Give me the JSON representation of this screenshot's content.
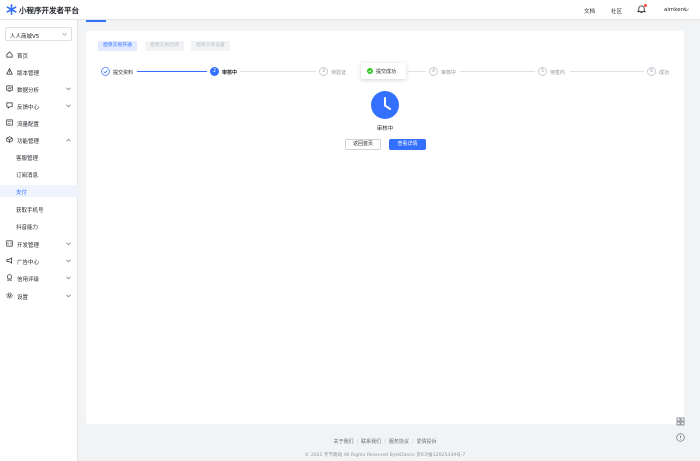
{
  "header": {
    "app_title": "小程序开发者平台",
    "links": [
      "文档",
      "社区"
    ],
    "user_name": "aimkent"
  },
  "sidebar": {
    "app_selector": "人人商城V5",
    "items": [
      {
        "label": "首页",
        "icon": "home-icon"
      },
      {
        "label": "版本管理",
        "icon": "version-icon"
      },
      {
        "label": "数据分析",
        "icon": "chart-icon",
        "expandable": true
      },
      {
        "label": "反馈中心",
        "icon": "feedback-icon",
        "expandable": true
      },
      {
        "label": "流量配置",
        "icon": "traffic-icon"
      },
      {
        "label": "功能管理",
        "icon": "feature-icon",
        "expandable": true,
        "expanded": true
      },
      {
        "label": "开发管理",
        "icon": "dev-icon",
        "expandable": true
      },
      {
        "label": "广告中心",
        "icon": "ad-icon",
        "expandable": true
      },
      {
        "label": "信用评级",
        "icon": "credit-icon",
        "expandable": true
      },
      {
        "label": "设置",
        "icon": "settings-icon",
        "expandable": true
      }
    ],
    "sub_items": [
      "客服管理",
      "订阅消息",
      "支付",
      "获取手机号",
      "抖音能力"
    ],
    "active_sub_item": "支付"
  },
  "tabs": [
    {
      "label": "担保交易开通",
      "state": "active"
    },
    {
      "label": "担保交易回调",
      "state": "disabled"
    },
    {
      "label": "担保交易设置",
      "state": "disabled"
    }
  ],
  "steps": [
    {
      "label": "提交资料",
      "state": "done",
      "index": "1"
    },
    {
      "label": "审核中",
      "state": "current",
      "index": "2"
    },
    {
      "label": "待验证",
      "state": "pending",
      "index": "3"
    },
    {
      "label": "审核中",
      "state": "pending",
      "index": "4"
    },
    {
      "label": "待签约",
      "state": "pending",
      "index": "5"
    },
    {
      "label": "成功",
      "state": "pending",
      "index": "6"
    }
  ],
  "toast": {
    "message": "提交成功"
  },
  "status": {
    "label": "审核中",
    "back_button": "返回首页",
    "detail_button": "查看详情"
  },
  "footer": {
    "links": [
      "关于我们",
      "联系我们",
      "服务协议",
      "爱情投诉"
    ],
    "copyright": "© 2021 字节跳动 All Rights Reserved ByteDance 京ICP备12025439号-7"
  },
  "colors": {
    "accent": "#3370ff",
    "success": "#34c724",
    "page_bg": "#f2f3f5"
  }
}
